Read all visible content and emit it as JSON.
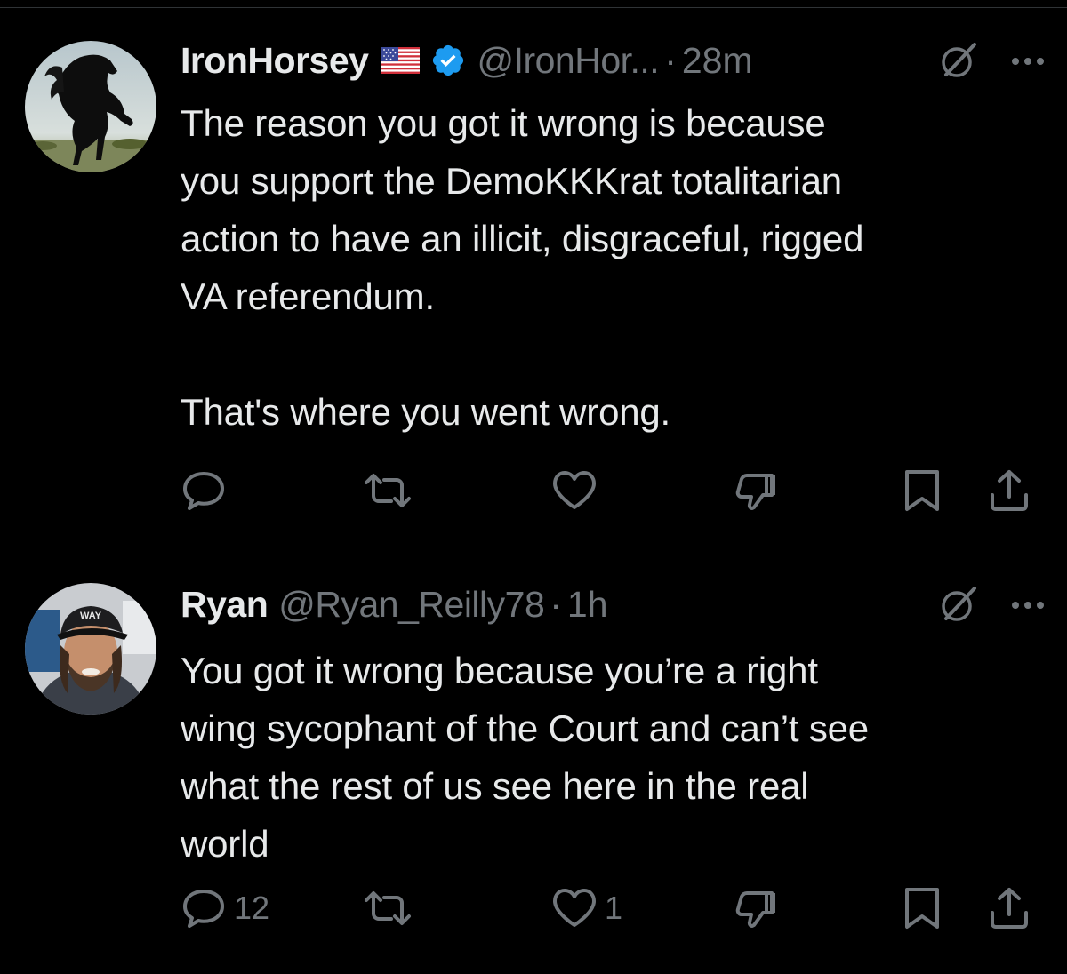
{
  "tweets": [
    {
      "name": "IronHorsey",
      "handle": "@IronHor...",
      "separator": "·",
      "time": "28m",
      "body": "The reason you got it wrong is because\nyou support the DemoKKKrat totalitarian\naction to have an illicit, disgraceful, rigged\nVA referendum.\n\nThat's where you went wrong.",
      "has_flag": true,
      "verified": true,
      "reply_count": "",
      "retweet_count": "",
      "like_count": ""
    },
    {
      "name": "Ryan",
      "handle": "@Ryan_Reilly78",
      "separator": "·",
      "time": "1h",
      "body": "You got it wrong because you’re a right\nwing sycophant of the Court and can’t see\nwhat the rest of us see here in the real\nworld",
      "has_flag": false,
      "verified": false,
      "reply_count": "12",
      "retweet_count": "",
      "like_count": "1"
    }
  ],
  "icons": [
    "reply-icon",
    "retweet-icon",
    "like-icon",
    "dislike-icon",
    "bookmark-icon",
    "share-icon",
    "grok-icon",
    "more-icon",
    "verified-badge-icon",
    "us-flag-icon"
  ],
  "colors": {
    "background": "#000000",
    "text": "#e7e9ea",
    "muted": "#71767b",
    "verified": "#1d9bf0",
    "divider": "#2f3336"
  }
}
